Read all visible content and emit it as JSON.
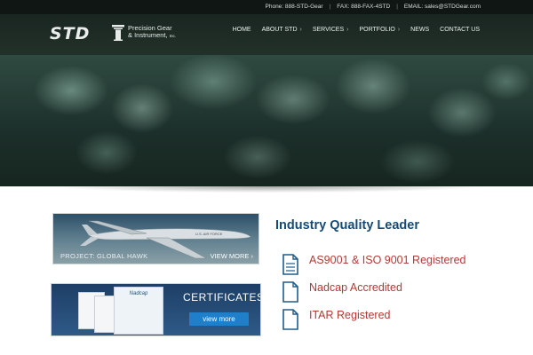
{
  "topbar": {
    "phone": "Phone: 888-STD-Gear",
    "fax": "FAX: 888-FAX-4STD",
    "email": "EMAIL: sales@STDGear.com",
    "separator": "|"
  },
  "logo": {
    "mark": "STD",
    "name_line1": "Precision Gear",
    "name_line2": "& Instrument,",
    "suffix": "Inc."
  },
  "nav": {
    "items": [
      {
        "label": "HOME",
        "has_submenu": false
      },
      {
        "label": "ABOUT STD",
        "has_submenu": true
      },
      {
        "label": "SERVICES",
        "has_submenu": true
      },
      {
        "label": "PORTFOLIO",
        "has_submenu": true
      },
      {
        "label": "NEWS",
        "has_submenu": false
      },
      {
        "label": "CONTACT US",
        "has_submenu": false
      }
    ],
    "chevron": "›"
  },
  "promos": {
    "project": {
      "caption": "PROJECT: GLOBAL HAWK",
      "more": "VIEW MORE ›",
      "aircraft_markings": "U.S. AIR FORCE"
    },
    "certificates": {
      "title": "CERTIFICATES",
      "button": "view more",
      "doc_title": "Nadcap"
    }
  },
  "quality": {
    "title": "Industry Quality Leader",
    "items": [
      {
        "label": "AS9001 & ISO 9001 Registered",
        "icon": "document-icon"
      },
      {
        "label": "Nadcap Accredited",
        "icon": "document-icon"
      },
      {
        "label": "ITAR Registered",
        "icon": "document-icon"
      }
    ]
  },
  "colors": {
    "heading": "#174a73",
    "cert_text": "#b23a35",
    "nav_bg": "#1a2621",
    "button": "#1f7fc9"
  }
}
